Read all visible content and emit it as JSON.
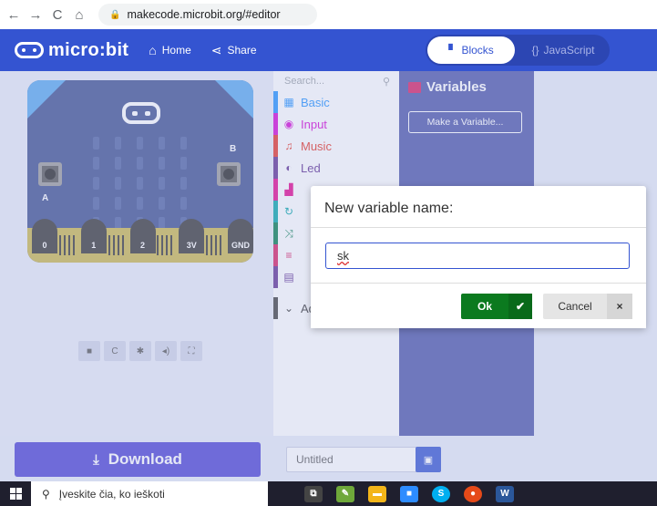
{
  "browser": {
    "url": "makecode.microbit.org/#editor",
    "icons": [
      "back-icon",
      "forward-icon",
      "reload-icon",
      "home-icon",
      "lock-icon"
    ]
  },
  "header": {
    "logo": "micro:bit",
    "home_label": "Home",
    "share_label": "Share",
    "tab_blocks": "Blocks",
    "tab_js": "JavaScript",
    "brand_color": "#3454d1"
  },
  "simulator": {
    "pins": [
      "0",
      "1",
      "2",
      "3V",
      "GND"
    ],
    "button_a": "A",
    "button_b": "B"
  },
  "toolbox": {
    "search_placeholder": "Search...",
    "categories": [
      {
        "label": "Basic",
        "color": "#1e90ff",
        "icon": "grid-icon"
      },
      {
        "label": "Input",
        "color": "#d400d4",
        "icon": "radio-icon"
      },
      {
        "label": "Music",
        "color": "#e63022",
        "icon": "headphones-icon"
      },
      {
        "label": "Led",
        "color": "#5c2d91",
        "icon": "toggle-icon"
      },
      {
        "label": "",
        "color": "#e3008c",
        "icon": "signal-icon"
      },
      {
        "label": "",
        "color": "#00a4a6",
        "icon": "loop-icon"
      },
      {
        "label": "",
        "color": "#007a4b",
        "icon": "shuffle-icon"
      },
      {
        "label": "",
        "color": "#d81b60",
        "icon": "list-icon"
      },
      {
        "label": "",
        "color": "#5c2d91",
        "icon": "calculator-icon"
      },
      {
        "label": "Advanced",
        "color": "#3c3c3c",
        "icon": "chevron-down-icon"
      }
    ]
  },
  "flyout": {
    "title": "Variables",
    "make_variable": "Make a Variable..."
  },
  "footer": {
    "download": "Download",
    "project_name": "Untitled"
  },
  "dialog": {
    "title": "New variable name:",
    "value": "sk",
    "ok": "Ok",
    "cancel": "Cancel"
  },
  "taskbar": {
    "search": "Įveskite čia, ko ieškoti"
  }
}
